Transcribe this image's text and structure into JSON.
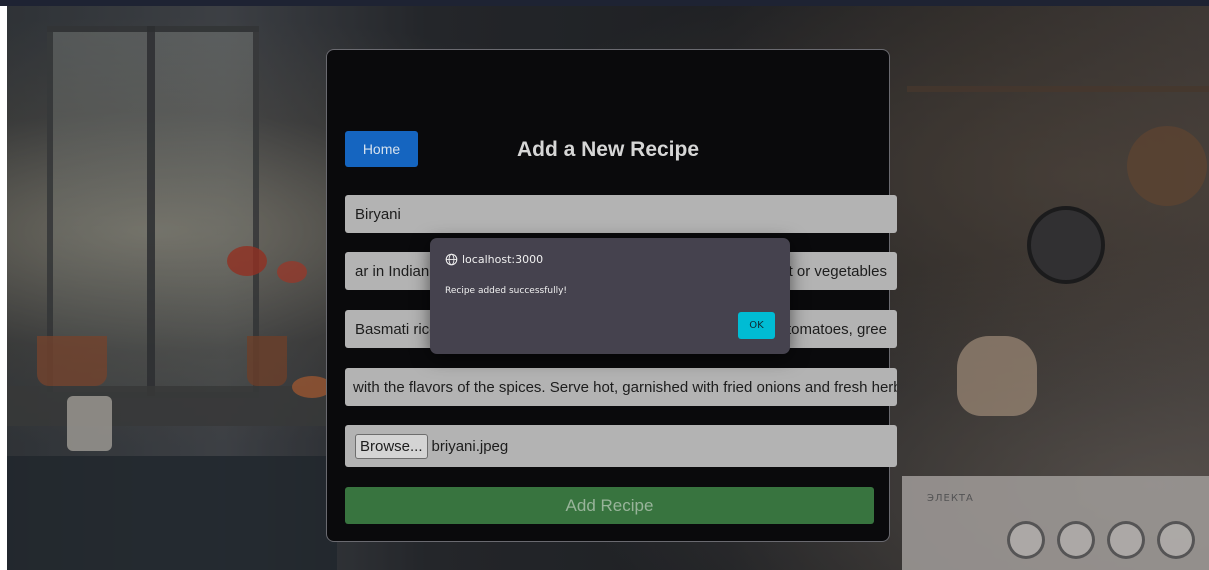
{
  "page": {
    "title": "Add a New Recipe"
  },
  "nav": {
    "home_label": "Home"
  },
  "form": {
    "name_value": "Biryani",
    "description_left": "ar in Indian",
    "description_right": "at or vegetables",
    "ingredients_left": "Basmati rice",
    "ingredients_right": "tomatoes, gree",
    "instructions_value": "with the flavors of the spices. Serve hot, garnished with fried onions and fresh herbs.",
    "file_button_label": "Browse...",
    "file_name": "briyani.jpeg",
    "submit_label": "Add Recipe"
  },
  "dialog": {
    "origin": "localhost:3000",
    "message": "Recipe added successfully!",
    "ok_label": "OK",
    "origin_icon": "globe-icon"
  },
  "background": {
    "stove_label": "ЭЛЕКТА"
  },
  "colors": {
    "home_button": "#1565c0",
    "submit_button": "#38743f",
    "ok_button": "#00bcd4",
    "dialog_bg": "#45424e",
    "card_bg": "#0a0a0c"
  }
}
